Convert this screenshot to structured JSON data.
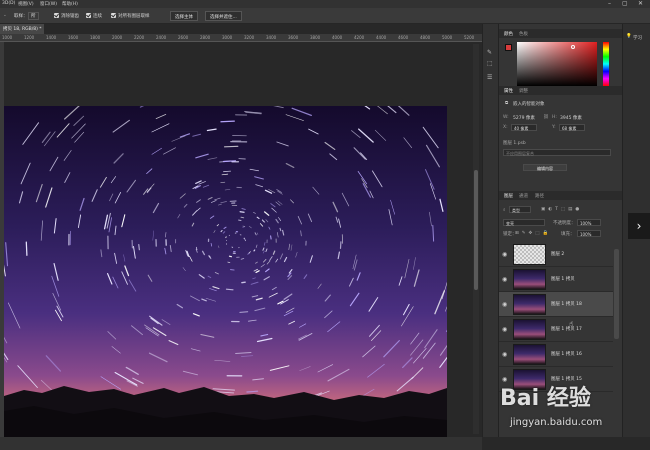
{
  "menubar": {
    "items": [
      "3D(D)",
      "视图(V)",
      "窗口(W)",
      "帮助(H)"
    ]
  },
  "options_bar": {
    "sample_label": "取样：",
    "sample_value": "所",
    "checkbox_1": "消除锯齿",
    "checkbox_2": "连续",
    "checkbox_3": "对所有图层取样",
    "select_subject_button": "选择主体",
    "select_and_mask_button": "选择并遮住..."
  },
  "document_tab": {
    "title": "拷贝 18, RGB/8) *"
  },
  "ruler": {
    "ticks": [
      "1000",
      "1200",
      "1400",
      "1600",
      "1800",
      "2000",
      "2200",
      "2400",
      "2600",
      "2800",
      "3000",
      "3200",
      "3400",
      "3600",
      "3800",
      "4000",
      "4200",
      "4400",
      "4600",
      "4800",
      "5000",
      "5200"
    ]
  },
  "color_panel": {
    "tabs": [
      "颜色",
      "色板"
    ],
    "foreground_color": "#d83c3c",
    "background_color": "#ffffff"
  },
  "properties_panel": {
    "tabs": [
      "属性",
      "调整"
    ],
    "type_label": "嵌入的智能对象",
    "w_label": "W:",
    "w_value": "5279 像素",
    "h_label": "H:",
    "h_value": "3945 像素",
    "x_label": "X:",
    "x_value": "40 像素",
    "y_label": "Y:",
    "y_value": "68 像素",
    "layer_comp_label": "图层 1.psb",
    "layer_comp_field": "不应用图层复合",
    "edit_content_button": "编辑内容"
  },
  "layers_panel": {
    "tabs": [
      "图层",
      "通道",
      "路径"
    ],
    "filter_label": "类型",
    "blend_mode": "变亮",
    "opacity_label": "不透明度：",
    "opacity_value": "100%",
    "lock_label": "锁定：",
    "fill_label": "填充：",
    "fill_value": "100%",
    "layers": [
      {
        "name": "图层 2",
        "thumb": "trans",
        "selected": false
      },
      {
        "name": "图层 1 拷贝",
        "thumb": "night",
        "selected": false
      },
      {
        "name": "图层 1 拷贝 18",
        "thumb": "night",
        "selected": true
      },
      {
        "name": "图层 1 拷贝 17",
        "thumb": "night",
        "selected": false
      },
      {
        "name": "图层 1 拷贝 16",
        "thumb": "night",
        "selected": false
      },
      {
        "name": "图层 1 拷贝 15",
        "thumb": "night",
        "selected": false
      }
    ]
  },
  "strip": {
    "learn_label": "学习"
  },
  "watermark": {
    "logo": "Bai 经验",
    "url": "jingyan.baidu.com"
  }
}
